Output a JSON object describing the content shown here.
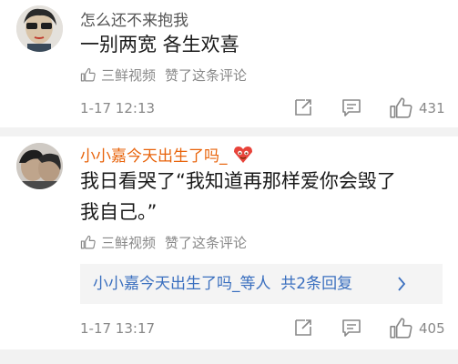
{
  "comments": [
    {
      "username": "怎么还不来抱我",
      "text": "一别两宽 各生欢喜",
      "liked_by": "三鲜视频",
      "liked_action": "赞了这条评论",
      "time": "1-17 12:13",
      "likes": "431"
    },
    {
      "username": "小小嘉今天出生了吗_",
      "text_line1": "我日看哭了“我知道再那样爱你会毁了",
      "text_line2": "我自己。”",
      "liked_by": "三鲜视频",
      "liked_action": "赞了这条评论",
      "reply_summary": "小小嘉今天出生了吗_等人  共2条回复",
      "time": "1-17 13:17",
      "likes": "405"
    }
  ],
  "icons": [
    "thumb-up-icon",
    "share-edit-icon",
    "comment-icon",
    "like-icon",
    "chevron-right-icon",
    "emoji-badge-icon"
  ],
  "colors": {
    "username_vip": "#e8640c",
    "link": "#3a6fbf",
    "meta": "#888888"
  }
}
